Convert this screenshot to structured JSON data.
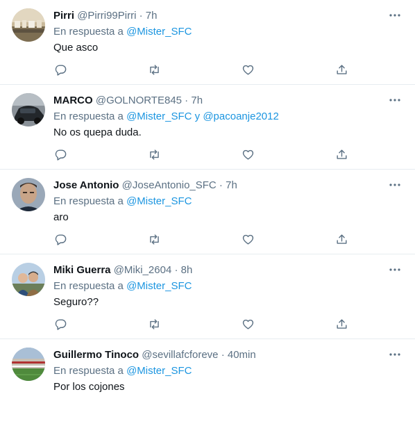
{
  "tweets": [
    {
      "name": "Pirri",
      "handle": "@Pirri99Pirri",
      "sep": " · ",
      "time": "7h",
      "reply_prefix": "En respuesta a ",
      "mention1": "@Mister_SFC",
      "conj": "",
      "mention2": "",
      "text": "Que asco",
      "avatar": "pirri-avatar"
    },
    {
      "name": "MARCO",
      "handle": "@GOLNORTE845",
      "sep": " · ",
      "time": "7h",
      "reply_prefix": "En respuesta a ",
      "mention1": "@Mister_SFC",
      "conj": " y ",
      "mention2": "@pacoanje2012",
      "text": "No os quepa duda.",
      "avatar": "marco-avatar"
    },
    {
      "name": "Jose Antonio",
      "handle": "@JoseAntonio_SFC",
      "sep": " · ",
      "time": "7h",
      "reply_prefix": "En respuesta a ",
      "mention1": "@Mister_SFC",
      "conj": "",
      "mention2": "",
      "text": "aro",
      "avatar": "jose-antonio-avatar"
    },
    {
      "name": "Miki Guerra",
      "handle": "@Miki_2604",
      "sep": " · ",
      "time": "8h",
      "reply_prefix": "En respuesta a ",
      "mention1": "@Mister_SFC",
      "conj": "",
      "mention2": "",
      "text": "Seguro??",
      "avatar": "miki-avatar"
    },
    {
      "name": "Guillermo Tinoco",
      "handle": "@sevillafcforeve",
      "sep": " · ",
      "time": "40min",
      "reply_prefix": "En respuesta a ",
      "mention1": "@Mister_SFC",
      "conj": "",
      "mention2": "",
      "text": "Por los cojones",
      "avatar": "guillermo-avatar"
    }
  ],
  "icons": {
    "more": "more-icon",
    "reply": "reply-icon",
    "retweet": "retweet-icon",
    "like": "like-icon",
    "share": "share-icon"
  },
  "colors": {
    "primary_text": "#0f1419",
    "secondary_text": "#5b7083",
    "link": "#1b95e0",
    "divider": "#e6ecf0"
  }
}
